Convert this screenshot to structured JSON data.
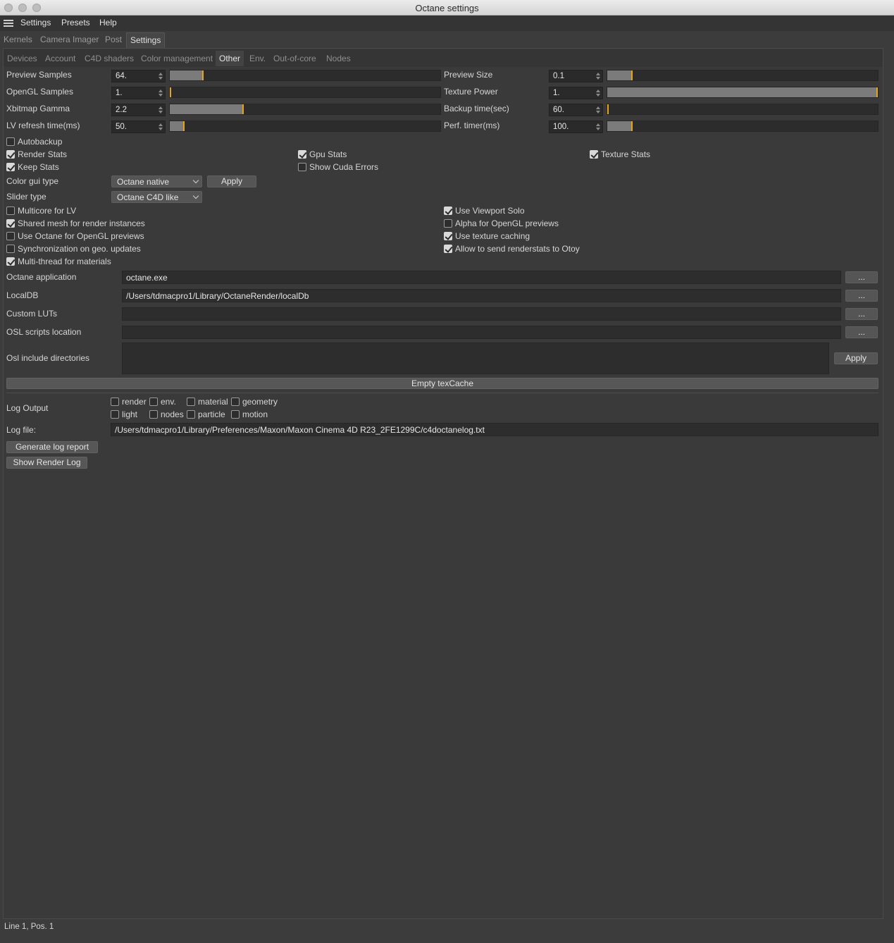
{
  "window": {
    "title": "Octane settings"
  },
  "menu": [
    "Settings",
    "Presets",
    "Help"
  ],
  "main_tabs": [
    "Kernels",
    "Camera Imager",
    "Post",
    "Settings"
  ],
  "active_main_tab": "Settings",
  "sub_tabs": [
    "Devices",
    "Account",
    "C4D shaders",
    "Color management",
    "Other",
    "Env.",
    "Out-of-core",
    "Nodes"
  ],
  "active_sub_tab": "Other",
  "params": [
    {
      "label": "Preview Samples",
      "value": "64.",
      "fill": 0.12
    },
    {
      "label": "OpenGL Samples",
      "value": "1.",
      "fill": 0.0
    },
    {
      "label": "Xbitmap Gamma",
      "value": "2.2",
      "fill": 0.27
    },
    {
      "label": "LV refresh time(ms)",
      "value": "50.",
      "fill": 0.05
    },
    {
      "label": "Preview Size",
      "value": "0.1",
      "fill": 0.09
    },
    {
      "label": "Texture Power",
      "value": "1.",
      "fill": 1.0
    },
    {
      "label": "Backup time(sec)",
      "value": "60.",
      "fill": 0.0
    },
    {
      "label": "Perf. timer(ms)",
      "value": "100.",
      "fill": 0.09
    }
  ],
  "checks_a": [
    {
      "label": "Autobackup",
      "checked": false
    },
    {
      "label": "Render Stats",
      "checked": true
    },
    {
      "label": "Keep Stats",
      "checked": true
    },
    {
      "label": "Gpu Stats",
      "checked": true
    },
    {
      "label": "Show Cuda Errors",
      "checked": false
    },
    {
      "label": "Texture Stats",
      "checked": true
    }
  ],
  "color_gui": {
    "label": "Color gui type",
    "value": "Octane native",
    "apply": "Apply"
  },
  "slider_type": {
    "label": "Slider type",
    "value": "Octane C4D like"
  },
  "checks_b": [
    {
      "label": "Multicore for LV",
      "checked": false
    },
    {
      "label": "Shared mesh for render instances",
      "checked": true
    },
    {
      "label": "Use Octane for OpenGL previews",
      "checked": false
    },
    {
      "label": "Synchronization on geo. updates",
      "checked": false
    },
    {
      "label": "Multi-thread for materials",
      "checked": true
    },
    {
      "label": "Use Viewport Solo",
      "checked": true
    },
    {
      "label": "Alpha for OpenGL previews",
      "checked": false
    },
    {
      "label": "Use texture caching",
      "checked": true
    },
    {
      "label": "Allow to send renderstats to Otoy",
      "checked": true
    }
  ],
  "paths": [
    {
      "label": "Octane application",
      "value": "octane.exe",
      "browse": "..."
    },
    {
      "label": "LocalDB",
      "value": "/Users/tdmacpro1/Library/OctaneRender/localDb",
      "browse": "..."
    },
    {
      "label": "Custom LUTs",
      "value": "",
      "browse": "..."
    },
    {
      "label": "OSL scripts location",
      "value": "",
      "browse": "..."
    }
  ],
  "osl_include": {
    "label": "Osl include directories",
    "apply": "Apply"
  },
  "empty_texcache": "Empty texCache",
  "log_output": {
    "label": "Log Output",
    "options": [
      {
        "label": "render",
        "checked": false
      },
      {
        "label": "env.",
        "checked": false
      },
      {
        "label": "material",
        "checked": false
      },
      {
        "label": "geometry",
        "checked": false
      },
      {
        "label": "light",
        "checked": false
      },
      {
        "label": "nodes",
        "checked": false
      },
      {
        "label": "particle",
        "checked": false
      },
      {
        "label": "motion",
        "checked": false
      }
    ]
  },
  "log_file": {
    "label": "Log file:",
    "value": "/Users/tdmacpro1/Library/Preferences/Maxon/Maxon Cinema 4D R23_2FE1299C/c4doctanelog.txt"
  },
  "buttons": {
    "generate_log": "Generate log report",
    "show_render_log": "Show Render Log"
  },
  "status": "Line 1, Pos. 1",
  "colors": {
    "accent": "#e5a41c",
    "background": "#3a3a3a",
    "field": "#2d2d2d"
  }
}
